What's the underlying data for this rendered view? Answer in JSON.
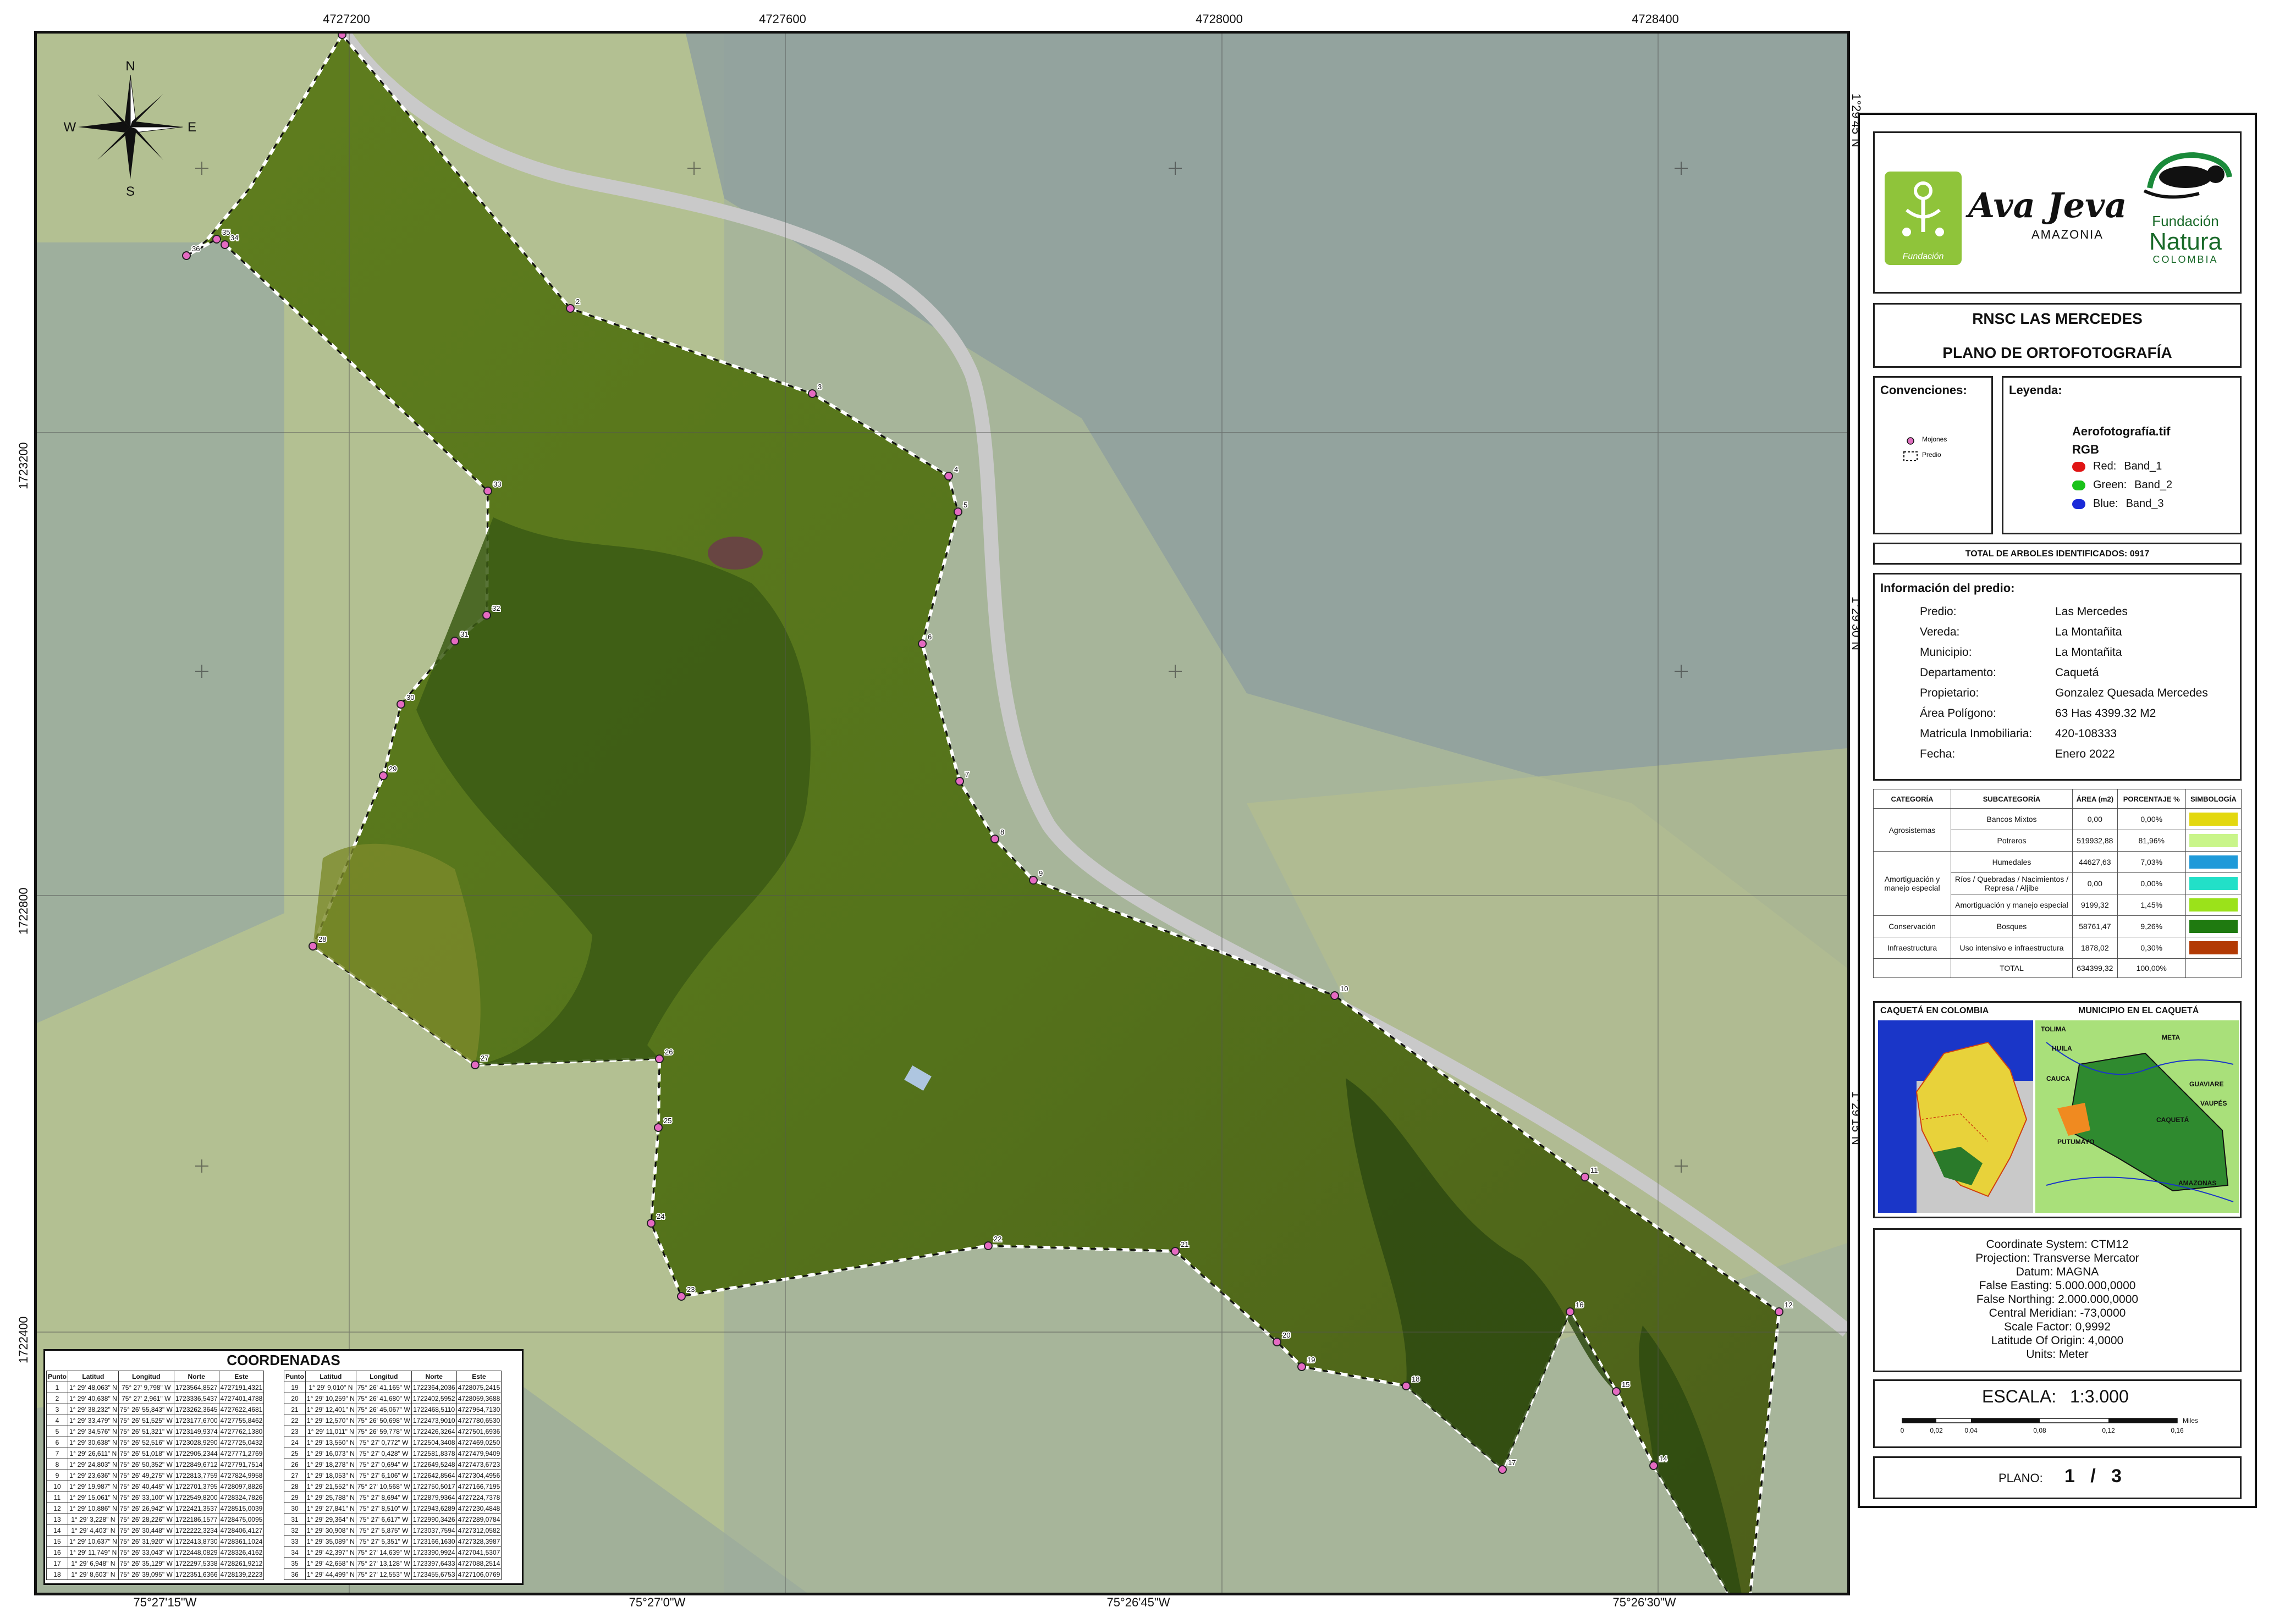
{
  "graticule": {
    "top_labels": [
      "4727200",
      "4727600",
      "4728000",
      "4728400"
    ],
    "bottom_labels": [
      "75°27'15\"W",
      "75°27'0\"W",
      "75°26'45\"W",
      "75°26'30\"W"
    ],
    "left_labels": [
      "1723200",
      "1722800",
      "1722400"
    ],
    "right_labels": [
      "1°29'45\"N",
      "1°29'30\"N",
      "1°29'15\"N"
    ]
  },
  "compass": {
    "n": "N",
    "s": "S",
    "e": "E",
    "w": "W"
  },
  "boundary_points": [
    "1",
    "2",
    "3",
    "4",
    "5",
    "6",
    "7",
    "8",
    "9",
    "10",
    "11",
    "12",
    "13",
    "14",
    "15",
    "16",
    "17",
    "18",
    "19",
    "20",
    "21",
    "22",
    "23",
    "24",
    "25",
    "26",
    "27",
    "28",
    "29",
    "30",
    "31",
    "32",
    "33",
    "34",
    "35",
    "36"
  ],
  "header": {
    "org1_name": "Ava Jeva",
    "org1_sub": "AMAZONIA",
    "org1_badge": "Fundación",
    "org2_line1": "Fundación",
    "org2_line2": "Natura",
    "org2_line3": "COLOMBIA",
    "title1": "RNSC LAS MERCEDES",
    "title2": "PLANO DE ORTOFOTOGRAFÍA"
  },
  "convenciones": {
    "title": "Convenciones:",
    "items": [
      "Mojones",
      "Predio"
    ]
  },
  "leyenda": {
    "title": "Leyenda:",
    "layer": "Aerofotografía.tif",
    "mode": "RGB",
    "bands": [
      {
        "label": "Red:",
        "value": "Band_1",
        "color": "#e01515"
      },
      {
        "label": "Green:",
        "value": "Band_2",
        "color": "#19c219"
      },
      {
        "label": "Blue:",
        "value": "Band_3",
        "color": "#1a2ad8"
      }
    ]
  },
  "total_trees": "TOTAL DE ARBOLES IDENTIFICADOS:  0917",
  "info": {
    "title": "Información del predio:",
    "rows": [
      {
        "k": "Predio:",
        "v": "Las Mercedes"
      },
      {
        "k": "Vereda:",
        "v": "La Montañita"
      },
      {
        "k": "Municipio:",
        "v": "La Montañita"
      },
      {
        "k": "Departamento:",
        "v": "Caquetá"
      },
      {
        "k": "Propietario:",
        "v": "Gonzalez Quesada Mercedes"
      },
      {
        "k": "Área Polígono:",
        "v": "63 Has 4399.32 M2"
      },
      {
        "k": "Matricula Inmobiliaria:",
        "v": "420-108333"
      },
      {
        "k": "Fecha:",
        "v": "Enero 2022"
      }
    ]
  },
  "categories": {
    "headers": [
      "CATEGORÍA",
      "SUBCATEGORÍA",
      "ÁREA (m2)",
      "PORCENTAJE %",
      "SIMBOLOGÍA"
    ],
    "groups": [
      {
        "cat": "Agrosistemas",
        "rows": [
          {
            "sub": "Bancos Mixtos",
            "area": "0,00",
            "pct": "0,00%",
            "color": "#e3d80f"
          },
          {
            "sub": "Potreros",
            "area": "519932,88",
            "pct": "81,96%",
            "color": "#c9f58a"
          }
        ]
      },
      {
        "cat": "Amortiguación y manejo especial",
        "rows": [
          {
            "sub": "Humedales",
            "area": "44627,63",
            "pct": "7,03%",
            "color": "#1f9ad9"
          },
          {
            "sub": "Ríos / Quebradas / Nacimientos / Represa / Aljibe",
            "area": "0,00",
            "pct": "0,00%",
            "color": "#22e0c8"
          },
          {
            "sub": "Amortiguación y manejo especial",
            "area": "9199,32",
            "pct": "1,45%",
            "color": "#9be21a"
          }
        ]
      },
      {
        "cat": "Conservación",
        "rows": [
          {
            "sub": "Bosques",
            "area": "58761,47",
            "pct": "9,26%",
            "color": "#1f7a10"
          }
        ]
      },
      {
        "cat": "Infraestructura",
        "rows": [
          {
            "sub": "Uso intensivo e infraestructura",
            "area": "1878,02",
            "pct": "0,30%",
            "color": "#b23a05"
          }
        ]
      }
    ],
    "total": {
      "label": "TOTAL",
      "area": "634399,32",
      "pct": "100,00%"
    }
  },
  "locator": {
    "title_left": "CAQUETÁ EN COLOMBIA",
    "title_right": "MUNICIPIO EN EL CAQUETÁ",
    "right_labels": [
      "TOLIMA",
      "HUILA",
      "META",
      "CAUCA",
      "GUAVIARE",
      "CAQUETÁ",
      "VAUPÉS",
      "PUTUMAYO",
      "AMAZONAS"
    ]
  },
  "projection": [
    "Coordinate System: CTM12",
    "Projection: Transverse Mercator",
    "Datum: MAGNA",
    "False Easting: 5.000.000,0000",
    "False Northing: 2.000.000,0000",
    "Central Meridian: -73,0000",
    "Scale Factor: 0,9992",
    "Latitude Of Origin: 4,0000",
    "Units: Meter"
  ],
  "scale": {
    "label": "ESCALA:",
    "value": "1:3.000",
    "ticks": [
      "0",
      "0,02",
      "0,04",
      "0,08",
      "0,12",
      "0,16"
    ],
    "unit": "Miles"
  },
  "plano": {
    "label": "PLANO:",
    "value": "1   /   3"
  },
  "coords": {
    "title": "COORDENADAS",
    "headers": [
      "Punto",
      "Latitud",
      "Longitud",
      "Norte",
      "Este"
    ],
    "rows": [
      [
        "1",
        "1° 29' 48,063\" N",
        "75° 27' 9,798\" W",
        "1723564,8527",
        "4727191,4321"
      ],
      [
        "2",
        "1° 29' 40,638\" N",
        "75° 27' 2,961\" W",
        "1723336,5437",
        "4727401,4788"
      ],
      [
        "3",
        "1° 29' 38,232\" N",
        "75° 26' 55,843\" W",
        "1723262,3645",
        "4727622,4681"
      ],
      [
        "4",
        "1° 29' 33,479\" N",
        "75° 26' 51,525\" W",
        "1723177,6700",
        "4727755,8462"
      ],
      [
        "5",
        "1° 29' 34,576\" N",
        "75° 26' 51,321\" W",
        "1723149,9374",
        "4727762,1380"
      ],
      [
        "6",
        "1° 29' 30,638\" N",
        "75° 26' 52,516\" W",
        "1723028,9290",
        "4727725,0432"
      ],
      [
        "7",
        "1° 29' 26,611\" N",
        "75° 26' 51,018\" W",
        "1722905,2344",
        "4727771,2769"
      ],
      [
        "8",
        "1° 29' 24,803\" N",
        "75° 26' 50,352\" W",
        "1722849,6712",
        "4727791,7514"
      ],
      [
        "9",
        "1° 29' 23,636\" N",
        "75° 26' 49,275\" W",
        "1722813,7759",
        "4727824,9958"
      ],
      [
        "10",
        "1° 29' 19,987\" N",
        "75° 26' 40,445\" W",
        "1722701,3795",
        "4728097,8826"
      ],
      [
        "11",
        "1° 29' 15,061\" N",
        "75° 26' 33,100\" W",
        "1722549,8200",
        "4728324,7826"
      ],
      [
        "12",
        "1° 29' 10,886\" N",
        "75° 26' 26,942\" W",
        "1722421,3537",
        "4728515,0039"
      ],
      [
        "13",
        "1° 29' 3,228\" N",
        "75° 26' 28,226\" W",
        "1722186,1577",
        "4728475,0095"
      ],
      [
        "14",
        "1° 29' 4,403\" N",
        "75° 26' 30,448\" W",
        "1722222,3234",
        "4728406,4127"
      ],
      [
        "15",
        "1° 29' 10,637\" N",
        "75° 26' 31,920\" W",
        "1722413,8730",
        "4728361,1024"
      ],
      [
        "16",
        "1° 29' 11,749\" N",
        "75° 26' 33,043\" W",
        "1722448,0829",
        "4728326,4162"
      ],
      [
        "17",
        "1° 29' 6,948\" N",
        "75° 26' 35,129\" W",
        "1722297,5338",
        "4728261,9212"
      ],
      [
        "18",
        "1° 29' 8,603\" N",
        "75° 26' 39,095\" W",
        "1722351,6366",
        "4728139,2223"
      ],
      [
        "19",
        "1° 29' 9,010\" N",
        "75° 26' 41,165\" W",
        "1722364,2036",
        "4728075,2415"
      ],
      [
        "20",
        "1° 29' 10,259\" N",
        "75° 26' 41,680\" W",
        "1722402,5952",
        "4728059,3688"
      ],
      [
        "21",
        "1° 29' 12,401\" N",
        "75° 26' 45,067\" W",
        "1722468,5110",
        "4727954,7130"
      ],
      [
        "22",
        "1° 29' 12,570\" N",
        "75° 26' 50,698\" W",
        "1722473,9010",
        "4727780,6530"
      ],
      [
        "23",
        "1° 29' 11,011\" N",
        "75° 26' 59,778\" W",
        "1722426,3264",
        "4727501,6936"
      ],
      [
        "24",
        "1° 29' 13,550\" N",
        "75° 27' 0,772\" W",
        "1722504,3408",
        "4727469,0250"
      ],
      [
        "25",
        "1° 29' 16,073\" N",
        "75° 27' 0,428\" W",
        "1722581,8378",
        "4727479,9409"
      ],
      [
        "26",
        "1° 29' 18,278\" N",
        "75° 27' 0,694\" W",
        "1722649,5248",
        "4727473,6723"
      ],
      [
        "27",
        "1° 29' 18,053\" N",
        "75° 27' 6,106\" W",
        "1722642,8564",
        "4727304,4956"
      ],
      [
        "28",
        "1° 29' 21,552\" N",
        "75° 27' 10,568\" W",
        "1722750,5017",
        "4727166,7195"
      ],
      [
        "29",
        "1° 29' 25,788\" N",
        "75° 27' 8,694\" W",
        "1722879,9364",
        "4727224,7378"
      ],
      [
        "30",
        "1° 29' 27,841\" N",
        "75° 27' 8,510\" W",
        "1722943,6289",
        "4727230,4848"
      ],
      [
        "31",
        "1° 29' 29,364\" N",
        "75° 27' 6,617\" W",
        "1722990,3426",
        "4727289,0784"
      ],
      [
        "32",
        "1° 29' 30,908\" N",
        "75° 27' 5,875\" W",
        "1723037,7594",
        "4727312,0582"
      ],
      [
        "33",
        "1° 29' 35,089\" N",
        "75° 27' 5,351\" W",
        "1723166,1630",
        "4727328,3987"
      ],
      [
        "34",
        "1° 29' 42,397\" N",
        "75° 27' 14,639\" W",
        "1723390,9924",
        "4727041,5307"
      ],
      [
        "35",
        "1° 29' 42,658\" N",
        "75° 27' 13,128\" W",
        "1723397,6433",
        "4727088,2514"
      ],
      [
        "36",
        "1° 29' 44,499\" N",
        "75° 27' 12,553\" W",
        "1723455,6753",
        "4727106,0769"
      ]
    ]
  }
}
